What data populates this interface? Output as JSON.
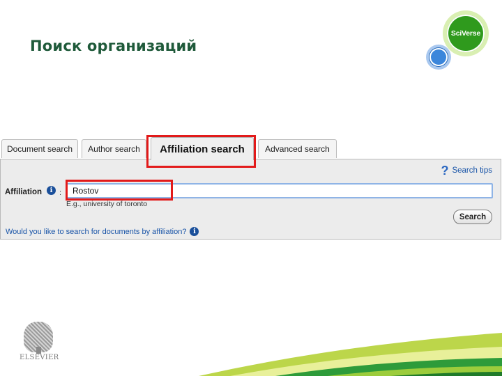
{
  "slide": {
    "title": "Поиск организаций"
  },
  "logo": {
    "brand_text": "SciVerse"
  },
  "tabs": [
    {
      "label": "Document search"
    },
    {
      "label": "Author search"
    },
    {
      "label": "Affiliation search"
    },
    {
      "label": "Advanced search"
    }
  ],
  "panel": {
    "search_tips": "Search tips",
    "field_label": "Affiliation",
    "colon": ":",
    "input_value": "Rostov",
    "example_text": "E.g., university of toronto",
    "search_button": "Search",
    "documents_link": "Would you like to search for documents by affiliation?"
  },
  "footer": {
    "publisher_logo_text": "ELSEVIER"
  },
  "colors": {
    "title": "#1f5a3a",
    "highlight": "#e21a1a",
    "link": "#1a55a8",
    "brand_green": "#2f9a1d",
    "brand_blue": "#3b86db"
  },
  "icons": [
    "question-icon",
    "info-icon",
    "sciverse-logo",
    "elsevier-tree-logo"
  ]
}
